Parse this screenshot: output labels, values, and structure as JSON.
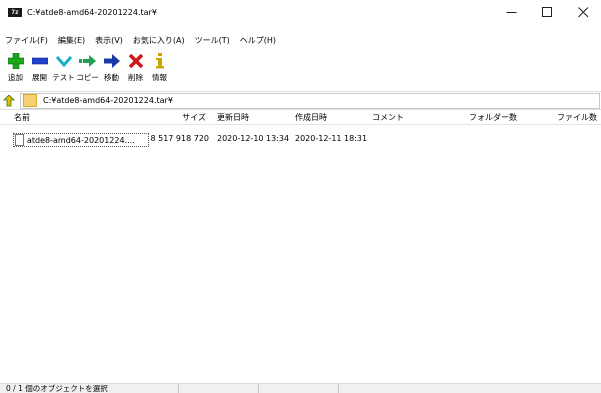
{
  "window": {
    "title": "C:¥atde8-amd64-20201224.tar¥",
    "app_icon_text": "7z"
  },
  "menu": [
    {
      "label": "ファイル(F)"
    },
    {
      "label": "編集(E)"
    },
    {
      "label": "表示(V)"
    },
    {
      "label": "お気に入り(A)"
    },
    {
      "label": "ツール(T)"
    },
    {
      "label": "ヘルプ(H)"
    }
  ],
  "toolbar": [
    {
      "label": "追加",
      "icon": "plus-icon",
      "color": "#1aa81a"
    },
    {
      "label": "展開",
      "icon": "minus-icon",
      "color": "#2244cc"
    },
    {
      "label": "テスト",
      "icon": "check-icon",
      "color": "#18b0c8"
    },
    {
      "label": "コピー",
      "icon": "double-arrow-icon",
      "color": "#20a050"
    },
    {
      "label": "移動",
      "icon": "arrow-right-icon",
      "color": "#1a3aa8"
    },
    {
      "label": "削除",
      "icon": "x-icon",
      "color": "#d01818"
    },
    {
      "label": "情報",
      "icon": "info-icon",
      "color": "#c8a800"
    }
  ],
  "address": {
    "path": "C:¥atde8-amd64-20201224.tar¥"
  },
  "columns": {
    "name": "名前",
    "size": "サイズ",
    "modified": "更新日時",
    "created": "作成日時",
    "comment": "コメント",
    "folders": "フォルダー数",
    "files": "ファイル数"
  },
  "rows": [
    {
      "name": "atde8-amd64-20201224....",
      "size": "8 517 918 720",
      "modified": "2020-12-10 13:34",
      "created": "2020-12-11 18:31"
    }
  ],
  "status": {
    "text": "0 / 1 個のオブジェクトを選択"
  }
}
